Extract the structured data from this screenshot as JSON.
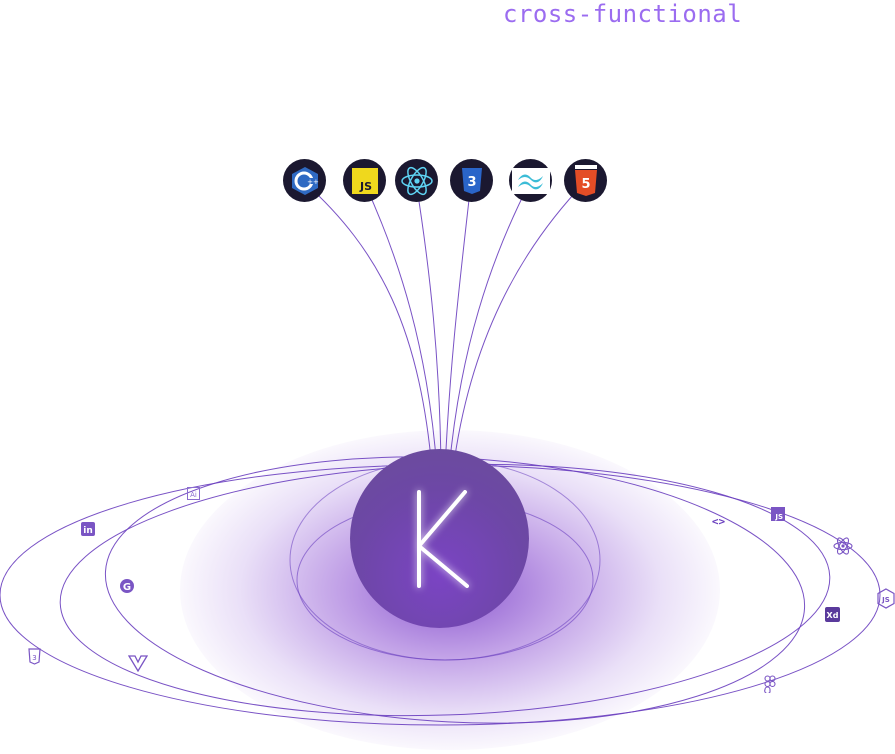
{
  "headline": "cross-functional",
  "center_logo": {
    "letter": "K"
  },
  "tech_stack": [
    {
      "icon": "cplusplus-icon"
    },
    {
      "icon": "javascript-icon",
      "label": "JS"
    },
    {
      "icon": "react-icon"
    },
    {
      "icon": "css3-icon",
      "label": "3"
    },
    {
      "icon": "tailwind-icon"
    },
    {
      "icon": "html5-icon",
      "label": "5"
    }
  ],
  "orbit_icons": [
    {
      "icon": "illustrator-icon",
      "label": "Ai"
    },
    {
      "icon": "linkedin-icon",
      "label": "in"
    },
    {
      "icon": "google-icon",
      "label": "G"
    },
    {
      "icon": "css3-icon",
      "label": "3"
    },
    {
      "icon": "vue-icon",
      "label": "V"
    },
    {
      "icon": "code-brackets-icon",
      "label": "<>"
    },
    {
      "icon": "javascript-icon",
      "label": "JS"
    },
    {
      "icon": "react-icon"
    },
    {
      "icon": "xd-icon",
      "label": "Xd"
    },
    {
      "icon": "nodejs-icon",
      "label": "JS"
    },
    {
      "icon": "figma-icon"
    }
  ],
  "colors": {
    "accent": "#9b6cf0",
    "line": "#6a3fbf",
    "badge_bg": "#1b1830",
    "glow": "#7b44c4"
  }
}
